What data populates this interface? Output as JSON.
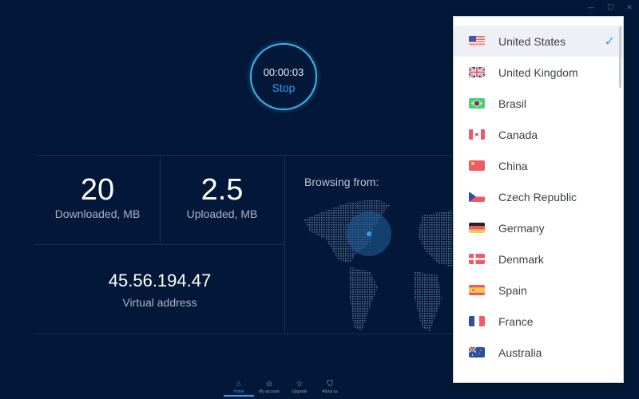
{
  "window_controls": {
    "minimize": "—",
    "maximize": "☐",
    "close": "✕"
  },
  "timer": {
    "time": "00:00:03",
    "stop_label": "Stop"
  },
  "stats": {
    "downloaded": {
      "value": "20",
      "label": "Downloaded, MB"
    },
    "uploaded": {
      "value": "2.5",
      "label": "Uploaded, MB"
    },
    "virtual_address": {
      "value": "45.56.194.47",
      "label": "Virtual address"
    }
  },
  "browsing_from_label": "Browsing from:",
  "country_dropdown": {
    "selected": "United States",
    "items": [
      {
        "name": "United States",
        "flag": "us-flag-icon",
        "selected": true
      },
      {
        "name": "United Kingdom",
        "flag": "uk-flag-icon"
      },
      {
        "name": "Brasil",
        "flag": "brazil-flag-icon"
      },
      {
        "name": "Canada",
        "flag": "canada-flag-icon"
      },
      {
        "name": "China",
        "flag": "china-flag-icon"
      },
      {
        "name": "Czech Republic",
        "flag": "czech-flag-icon"
      },
      {
        "name": "Germany",
        "flag": "germany-flag-icon"
      },
      {
        "name": "Denmark",
        "flag": "denmark-flag-icon"
      },
      {
        "name": "Spain",
        "flag": "spain-flag-icon"
      },
      {
        "name": "France",
        "flag": "france-flag-icon"
      },
      {
        "name": "Australia",
        "flag": "australia-flag-icon"
      }
    ]
  },
  "nav": [
    {
      "label": "Home",
      "icon": "home-icon",
      "active": true
    },
    {
      "label": "My account",
      "icon": "user-icon"
    },
    {
      "label": "Upgrade",
      "icon": "star-icon"
    },
    {
      "label": "About us",
      "icon": "shield-icon"
    }
  ],
  "colors": {
    "background": "#031838",
    "accent": "#2e9ff0",
    "timer_ring": "#3fb2ec"
  }
}
